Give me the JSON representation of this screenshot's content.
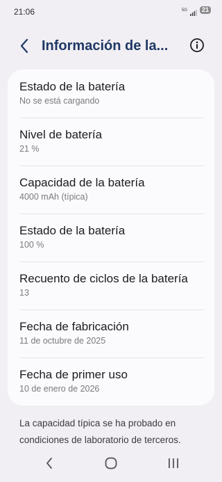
{
  "status_bar": {
    "time": "21:06",
    "network_label_top": "5G",
    "network_label_bottom": "",
    "battery_level": "21",
    "icons": [
      "signal-icon",
      "battery-icon"
    ]
  },
  "header": {
    "title": "Información de la...",
    "back_icon": "chevron-left-icon",
    "info_icon": "info-icon",
    "accent_color": "#1f3864"
  },
  "battery_info": {
    "items": [
      {
        "title": "Estado de la batería",
        "value": "No se está cargando"
      },
      {
        "title": "Nivel de batería",
        "value": "21 %"
      },
      {
        "title": "Capacidad de la batería",
        "value": "4000 mAh (típica)"
      },
      {
        "title": "Estado de la batería",
        "value": "100 %"
      },
      {
        "title": "Recuento de ciclos de la batería",
        "value": "13"
      },
      {
        "title": "Fecha de fabricación",
        "value": "11 de octubre de 2025"
      },
      {
        "title": "Fecha de primer uso",
        "value": "10 de enero de 2026"
      }
    ]
  },
  "footnote": "La capacidad típica se ha probado en condiciones de laboratorio de terceros.",
  "nav_bar": {
    "icons": [
      "back-nav-icon",
      "home-nav-icon",
      "recents-nav-icon"
    ]
  }
}
